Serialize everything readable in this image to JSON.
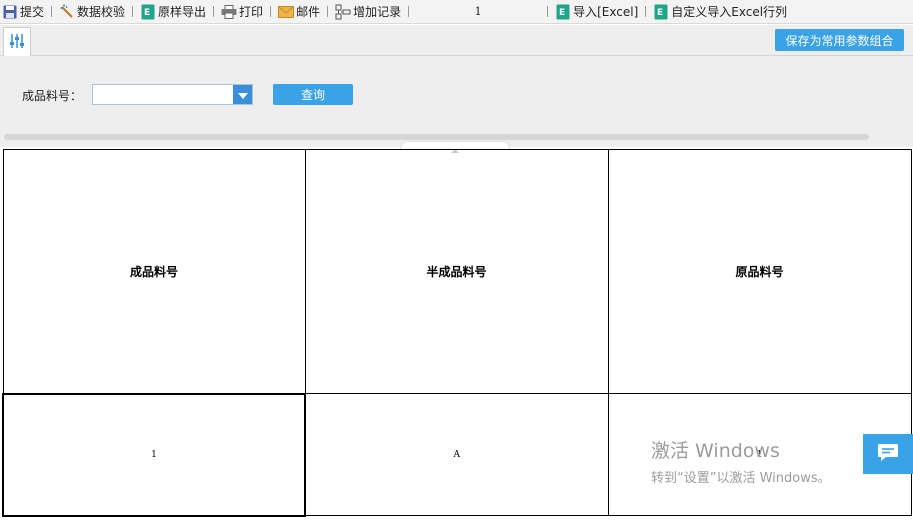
{
  "toolbar": {
    "submit_label": "提交",
    "validate_label": "数据校验",
    "export_label": "原样导出",
    "print_label": "打印",
    "mail_label": "邮件",
    "add_record_label": "增加记录",
    "page_number": "1",
    "import_label": "导入[Excel]",
    "custom_import_label": "自定义导入Excel行列"
  },
  "params": {
    "save_button_label": "保存为常用参数组合",
    "field_label": "成品料号：",
    "field_value": "",
    "query_button_label": "查询"
  },
  "table": {
    "headers": [
      "成品料号",
      "半成品料号",
      "原品料号"
    ],
    "rows": [
      [
        "1",
        "A",
        "1"
      ]
    ]
  },
  "watermark": {
    "line1": "激活 Windows",
    "line2": "转到“设置”以激活 Windows。"
  },
  "colors": {
    "accent": "#3aa2e6",
    "toolbar_bg": "#f3f3f3",
    "panel_bg": "#eeeeee"
  }
}
